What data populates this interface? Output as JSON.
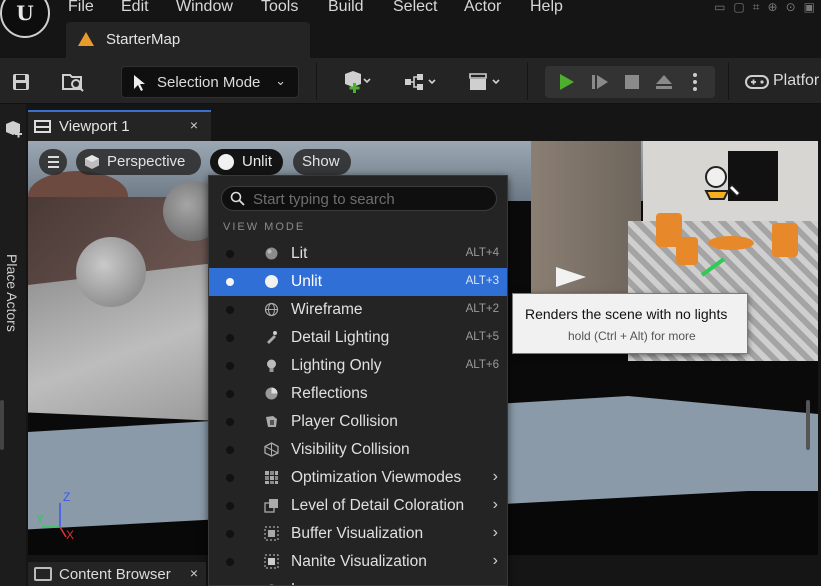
{
  "menubar": {
    "items": [
      "File",
      "Edit",
      "Window",
      "Tools",
      "Build",
      "Select",
      "Actor",
      "Help"
    ]
  },
  "level_tab": {
    "name": "StarterMap"
  },
  "toolbar": {
    "selection_mode": "Selection Mode",
    "platforms": "Platfor"
  },
  "left_panel": {
    "label": "Place Actors"
  },
  "viewport_tab": {
    "label": "Viewport 1",
    "close": "×"
  },
  "viewport_bar": {
    "perspective": "Perspective",
    "view_mode": "Unlit",
    "show": "Show"
  },
  "view_mode_menu": {
    "search_placeholder": "Start typing to search",
    "header": "VIEW MODE",
    "items": [
      {
        "label": "Lit",
        "shortcut": "ALT+4",
        "icon": "lit-sphere-icon"
      },
      {
        "label": "Unlit",
        "shortcut": "ALT+3",
        "icon": "unlit-sphere-icon",
        "selected": true
      },
      {
        "label": "Wireframe",
        "shortcut": "ALT+2",
        "icon": "wireframe-sphere-icon"
      },
      {
        "label": "Detail Lighting",
        "shortcut": "ALT+5",
        "icon": "detail-lighting-icon"
      },
      {
        "label": "Lighting Only",
        "shortcut": "ALT+6",
        "icon": "lightbulb-icon"
      },
      {
        "label": "Reflections",
        "shortcut": "",
        "icon": "reflections-icon"
      },
      {
        "label": "Player Collision",
        "shortcut": "",
        "icon": "player-collision-icon"
      },
      {
        "label": "Visibility Collision",
        "shortcut": "",
        "icon": "visibility-collision-icon"
      },
      {
        "label": "Optimization Viewmodes",
        "shortcut": "",
        "icon": "optimization-icon",
        "submenu": true
      },
      {
        "label": "Level of Detail Coloration",
        "shortcut": "",
        "icon": "lod-icon",
        "submenu": true
      },
      {
        "label": "Buffer Visualization",
        "shortcut": "",
        "icon": "buffer-icon",
        "submenu": true
      },
      {
        "label": "Nanite Visualization",
        "shortcut": "",
        "icon": "nanite-icon",
        "submenu": true
      },
      {
        "label": "Lumen",
        "shortcut": "",
        "icon": "lumen-icon",
        "submenu": true
      }
    ]
  },
  "tooltip": {
    "title": "Renders the scene with no lights",
    "hint": "hold (Ctrl + Alt) for more"
  },
  "bottom_tab": {
    "label": "Content Browser",
    "close": "×"
  },
  "gizmo": {
    "x": "X",
    "y": "Y",
    "z": "Z"
  },
  "colors": {
    "accent": "#2f6fd6",
    "play": "#4caf2e",
    "level_icon": "#e89a2a"
  }
}
